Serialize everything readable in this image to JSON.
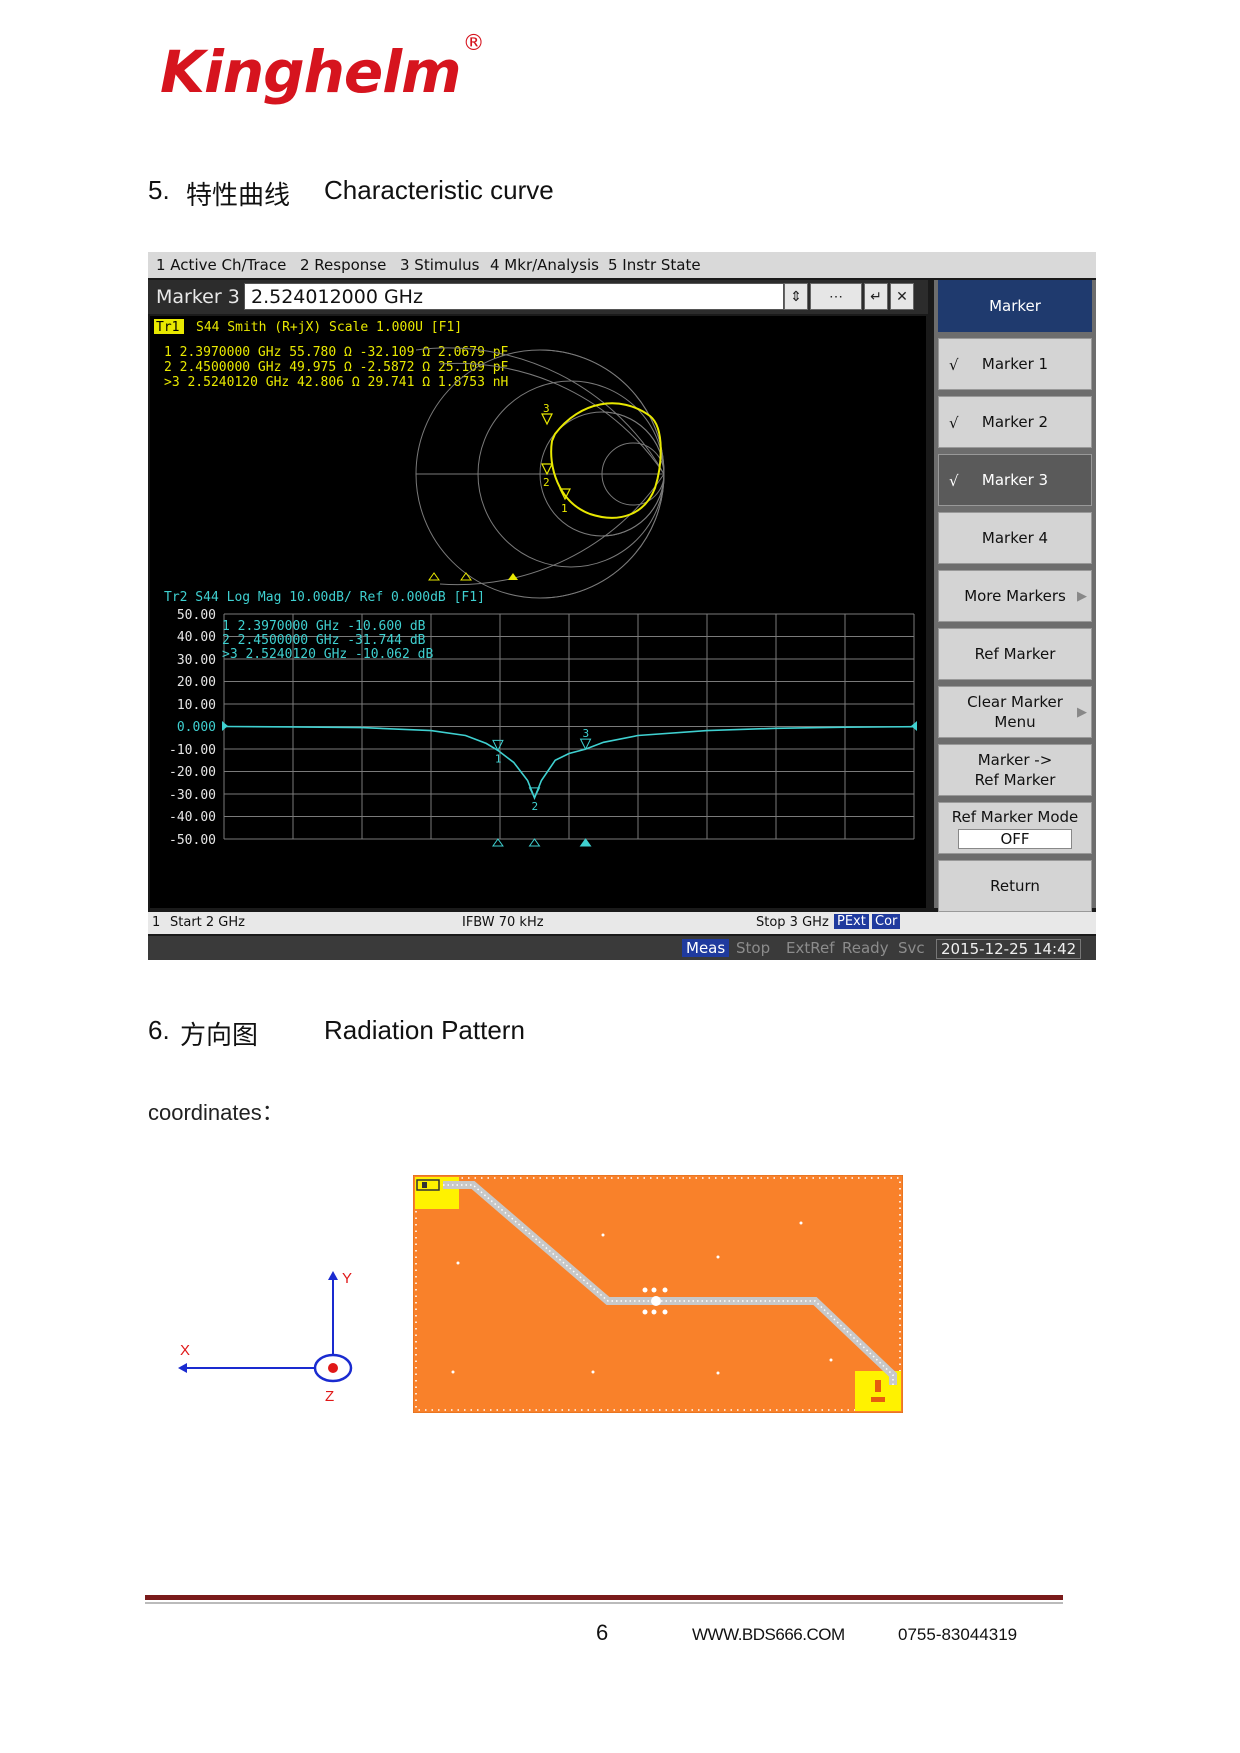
{
  "header": {
    "logo_text": "Kinghelm",
    "logo_mark": "®"
  },
  "section5": {
    "number": "5.",
    "title_cn": "特性曲线",
    "title_en": "Characteristic curve"
  },
  "section6": {
    "number": "6.",
    "title_cn": "方向图",
    "title_en": "Radiation Pattern",
    "coords_label": "coordinates："
  },
  "vna": {
    "menu": [
      "1 Active Ch/Trace",
      "2 Response",
      "3 Stimulus",
      "4 Mkr/Analysis",
      "5 Instr State"
    ],
    "entry_label": "Marker 3",
    "entry_value": "2.524012000 GHz",
    "smith": {
      "header": "Tr1 S44 Smith (R+jX) Scale 1.000U [F1]",
      "tag": "Tr1",
      "header_rest": "S44 Smith (R+jX) Scale 1.000U [F1]",
      "markers": [
        "  1  2.3970000 GHz  55.780 Ω  -32.109 Ω   2.0679 pF",
        "  2  2.4500000 GHz  49.975 Ω  -2.5872 Ω   25.109 pF",
        " >3  2.5240120 GHz  42.806 Ω  29.741 Ω   1.8753 nH"
      ]
    },
    "logmag": {
      "header": "Tr2 S44 Log Mag 10.00dB/ Ref 0.000dB [F1]",
      "markers": [
        "  1  2.3970000 GHz  -10.600  dB",
        "  2  2.4500000 GHz  -31.744  dB",
        " >3  2.5240120 GHz  -10.062  dB"
      ],
      "y_ticks": [
        "50.00",
        "40.00",
        "30.00",
        "20.00",
        "10.00",
        "0.000",
        "-10.00",
        "-20.00",
        "-30.00",
        "-40.00",
        "-50.00"
      ]
    },
    "softkeys": [
      {
        "label": "Marker",
        "style": "title"
      },
      {
        "label": "Marker 1",
        "check": "√"
      },
      {
        "label": "Marker 2",
        "check": "√"
      },
      {
        "label": "Marker 3",
        "check": "√",
        "style": "dark"
      },
      {
        "label": "Marker 4"
      },
      {
        "label": "More Markers",
        "arrow": true
      },
      {
        "label": "Ref Marker"
      },
      {
        "label": "Clear Marker Menu",
        "arrow": true
      },
      {
        "label": "Marker -> Ref Marker"
      },
      {
        "label": "Ref Marker Mode",
        "sub": "OFF"
      },
      {
        "label": "Return"
      }
    ],
    "status1": {
      "ch": "1",
      "start": "Start 2 GHz",
      "ifbw": "IFBW 70 kHz",
      "stop": "Stop 3 GHz",
      "pext": "PExt",
      "cor": "Cor"
    },
    "status2": {
      "meas": "Meas",
      "stop": "Stop",
      "extref": "ExtRef",
      "ready": "Ready",
      "svc": "Svc",
      "datetime": "2015-12-25 14:42"
    }
  },
  "axes": {
    "x": "X",
    "y": "Y",
    "z": "Z"
  },
  "footer": {
    "page": "6",
    "website": "WWW.BDS666.COM",
    "phone": "0755-83044319"
  },
  "chart_data": {
    "type": "line",
    "title": "Tr2 S44 Log Mag 10.00dB/ Ref 0.000dB [F1]",
    "xlabel": "",
    "ylabel": "",
    "xlim": [
      2.0,
      3.0
    ],
    "ylim": [
      -50,
      50
    ],
    "series": [
      {
        "x": [
          2.0,
          2.1,
          2.2,
          2.3,
          2.35,
          2.38,
          2.397,
          2.42,
          2.44,
          2.45,
          2.46,
          2.48,
          2.5,
          2.524,
          2.55,
          2.6,
          2.7,
          2.8,
          2.9,
          3.0
        ],
        "values": [
          0,
          -0.2,
          -0.5,
          -1.8,
          -4,
          -7.5,
          -10.6,
          -16,
          -24,
          -31.744,
          -24,
          -15,
          -12,
          -10.062,
          -7,
          -4,
          -1.8,
          -0.8,
          -0.3,
          -0.1
        ]
      }
    ]
  }
}
